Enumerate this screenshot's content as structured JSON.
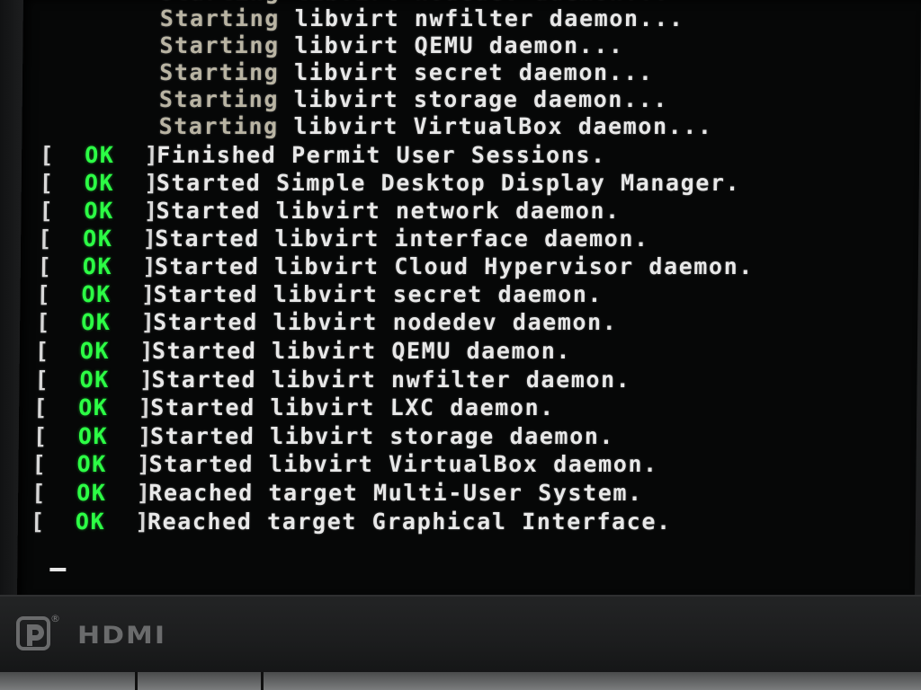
{
  "console": {
    "lines": [
      {
        "status": "",
        "verb": "Starting",
        "text": "libvirt nodedev daemon..."
      },
      {
        "status": "",
        "verb": "Starting",
        "text": "libvirt nwfilter daemon..."
      },
      {
        "status": "",
        "verb": "Starting",
        "text": "libvirt QEMU daemon..."
      },
      {
        "status": "",
        "verb": "Starting",
        "text": "libvirt secret daemon..."
      },
      {
        "status": "",
        "verb": "Starting",
        "text": "libvirt storage daemon..."
      },
      {
        "status": "",
        "verb": "Starting",
        "text": "libvirt VirtualBox daemon..."
      },
      {
        "status": "OK",
        "verb": "Finished",
        "text": "Permit User Sessions."
      },
      {
        "status": "OK",
        "verb": "Started",
        "text": "Simple Desktop Display Manager."
      },
      {
        "status": "OK",
        "verb": "Started",
        "text": "libvirt network daemon."
      },
      {
        "status": "OK",
        "verb": "Started",
        "text": "libvirt interface daemon."
      },
      {
        "status": "OK",
        "verb": "Started",
        "text": "libvirt Cloud Hypervisor daemon."
      },
      {
        "status": "OK",
        "verb": "Started",
        "text": "libvirt secret daemon."
      },
      {
        "status": "OK",
        "verb": "Started",
        "text": "libvirt nodedev daemon."
      },
      {
        "status": "OK",
        "verb": "Started",
        "text": "libvirt QEMU daemon."
      },
      {
        "status": "OK",
        "verb": "Started",
        "text": "libvirt nwfilter daemon."
      },
      {
        "status": "OK",
        "verb": "Started",
        "text": "libvirt LXC daemon."
      },
      {
        "status": "OK",
        "verb": "Started",
        "text": "libvirt storage daemon."
      },
      {
        "status": "OK",
        "verb": "Started",
        "text": "libvirt VirtualBox daemon."
      },
      {
        "status": "OK",
        "verb": "Reached",
        "text": "target Multi-User System."
      },
      {
        "status": "OK",
        "verb": "Reached",
        "text": "target Graphical Interface."
      }
    ],
    "cursor": "_"
  },
  "monitor": {
    "brand_mark": "DP",
    "registered": "®",
    "hdmi_label": "HDMI"
  },
  "colors": {
    "ok_green": "#2cff45",
    "text_white": "#e8e8e8",
    "dim_starting": "#b9b4a3",
    "screen_bg": "#060707",
    "bezel": "#1e1f20"
  }
}
